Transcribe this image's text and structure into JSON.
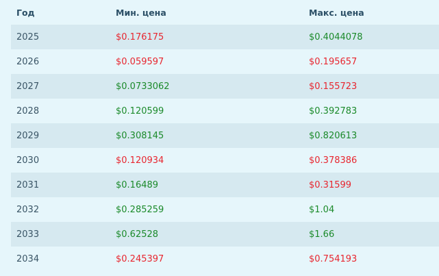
{
  "table": {
    "headers": {
      "year": "Год",
      "min": "Мин. цена",
      "max": "Макс. цена"
    },
    "colors": {
      "red": "#e8262f",
      "green": "#1b8a2a",
      "header_text": "#2b4f66",
      "row_alt": "#d6e9f0",
      "background": "#e6f6fb"
    },
    "rows": [
      {
        "year": "2025",
        "min": "$0.176175",
        "min_color": "red",
        "max": "$0.4044078",
        "max_color": "green"
      },
      {
        "year": "2026",
        "min": "$0.059597",
        "min_color": "red",
        "max": "$0.195657",
        "max_color": "red"
      },
      {
        "year": "2027",
        "min": "$0.0733062",
        "min_color": "green",
        "max": "$0.155723",
        "max_color": "red"
      },
      {
        "year": "2028",
        "min": "$0.120599",
        "min_color": "green",
        "max": "$0.392783",
        "max_color": "green"
      },
      {
        "year": "2029",
        "min": "$0.308145",
        "min_color": "green",
        "max": "$0.820613",
        "max_color": "green"
      },
      {
        "year": "2030",
        "min": "$0.120934",
        "min_color": "red",
        "max": "$0.378386",
        "max_color": "red"
      },
      {
        "year": "2031",
        "min": "$0.16489",
        "min_color": "green",
        "max": "$0.31599",
        "max_color": "red"
      },
      {
        "year": "2032",
        "min": "$0.285259",
        "min_color": "green",
        "max": "$1.04",
        "max_color": "green"
      },
      {
        "year": "2033",
        "min": "$0.62528",
        "min_color": "green",
        "max": "$1.66",
        "max_color": "green"
      },
      {
        "year": "2034",
        "min": "$0.245397",
        "min_color": "red",
        "max": "$0.754193",
        "max_color": "red"
      }
    ]
  }
}
